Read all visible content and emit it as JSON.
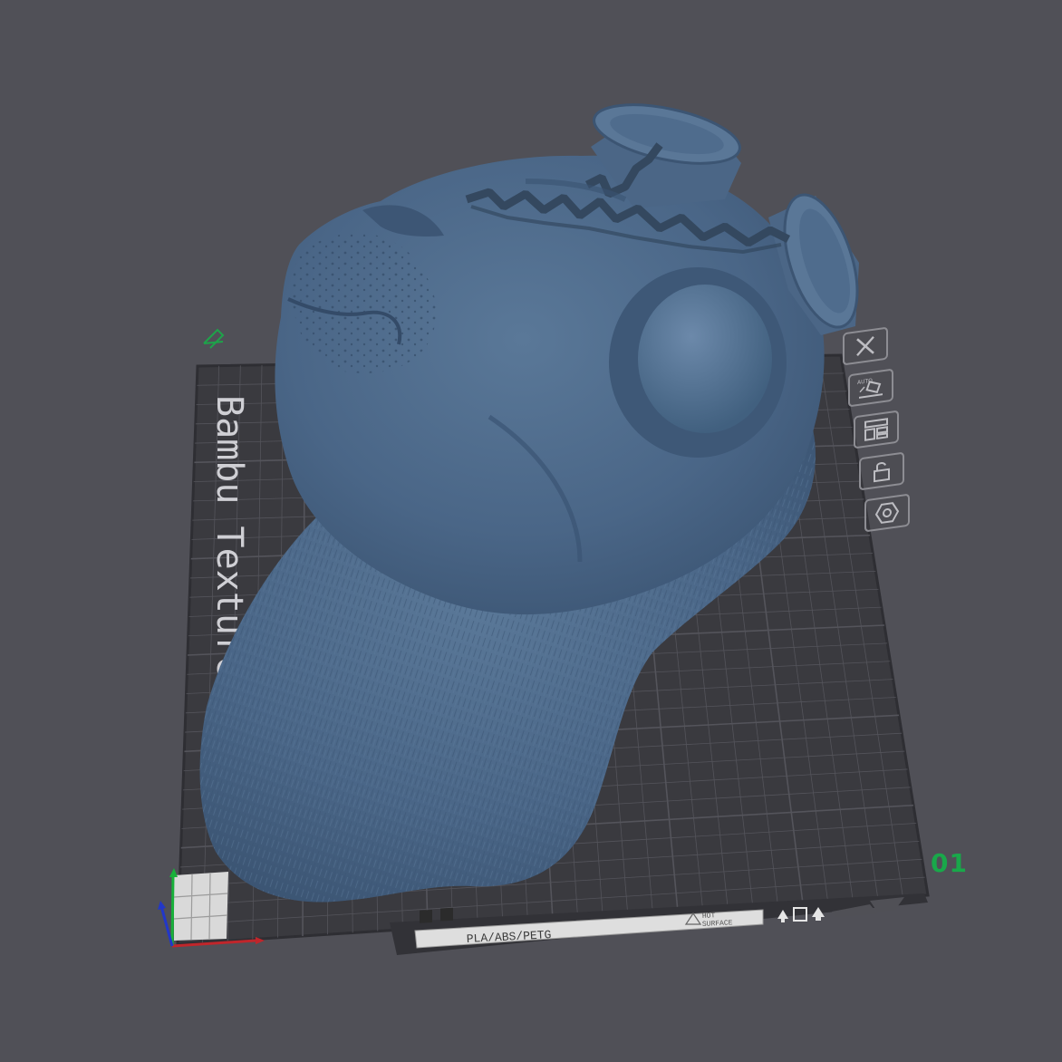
{
  "canvas": {
    "background": "#505057"
  },
  "build_plate": {
    "name": "Bambu Textured PET",
    "material_label": "PLA/ABS/PETG",
    "warning_label_line1": "HOT",
    "warning_label_line2": "SURFACE",
    "plate_index": "01",
    "plate_index_color": "#19a84a",
    "plate_color": "#3a3a3f",
    "grid_color": "#54545b"
  },
  "model": {
    "object_name": "creature-head-bust",
    "color": "#4d6a8c"
  },
  "plate_toolbar": {
    "items": [
      {
        "name": "close-plate-button",
        "icon": "x-icon"
      },
      {
        "name": "auto-orient-button",
        "icon": "auto-orient-icon",
        "text": "AUTO"
      },
      {
        "name": "arrange-button",
        "icon": "arrange-icon"
      },
      {
        "name": "lock-plate-button",
        "icon": "lock-icon"
      },
      {
        "name": "plate-settings-button",
        "icon": "hex-gear-icon"
      }
    ]
  },
  "axes": {
    "x_color": "#c0262b",
    "y_color": "#18b13a",
    "z_color": "#2237c8"
  }
}
